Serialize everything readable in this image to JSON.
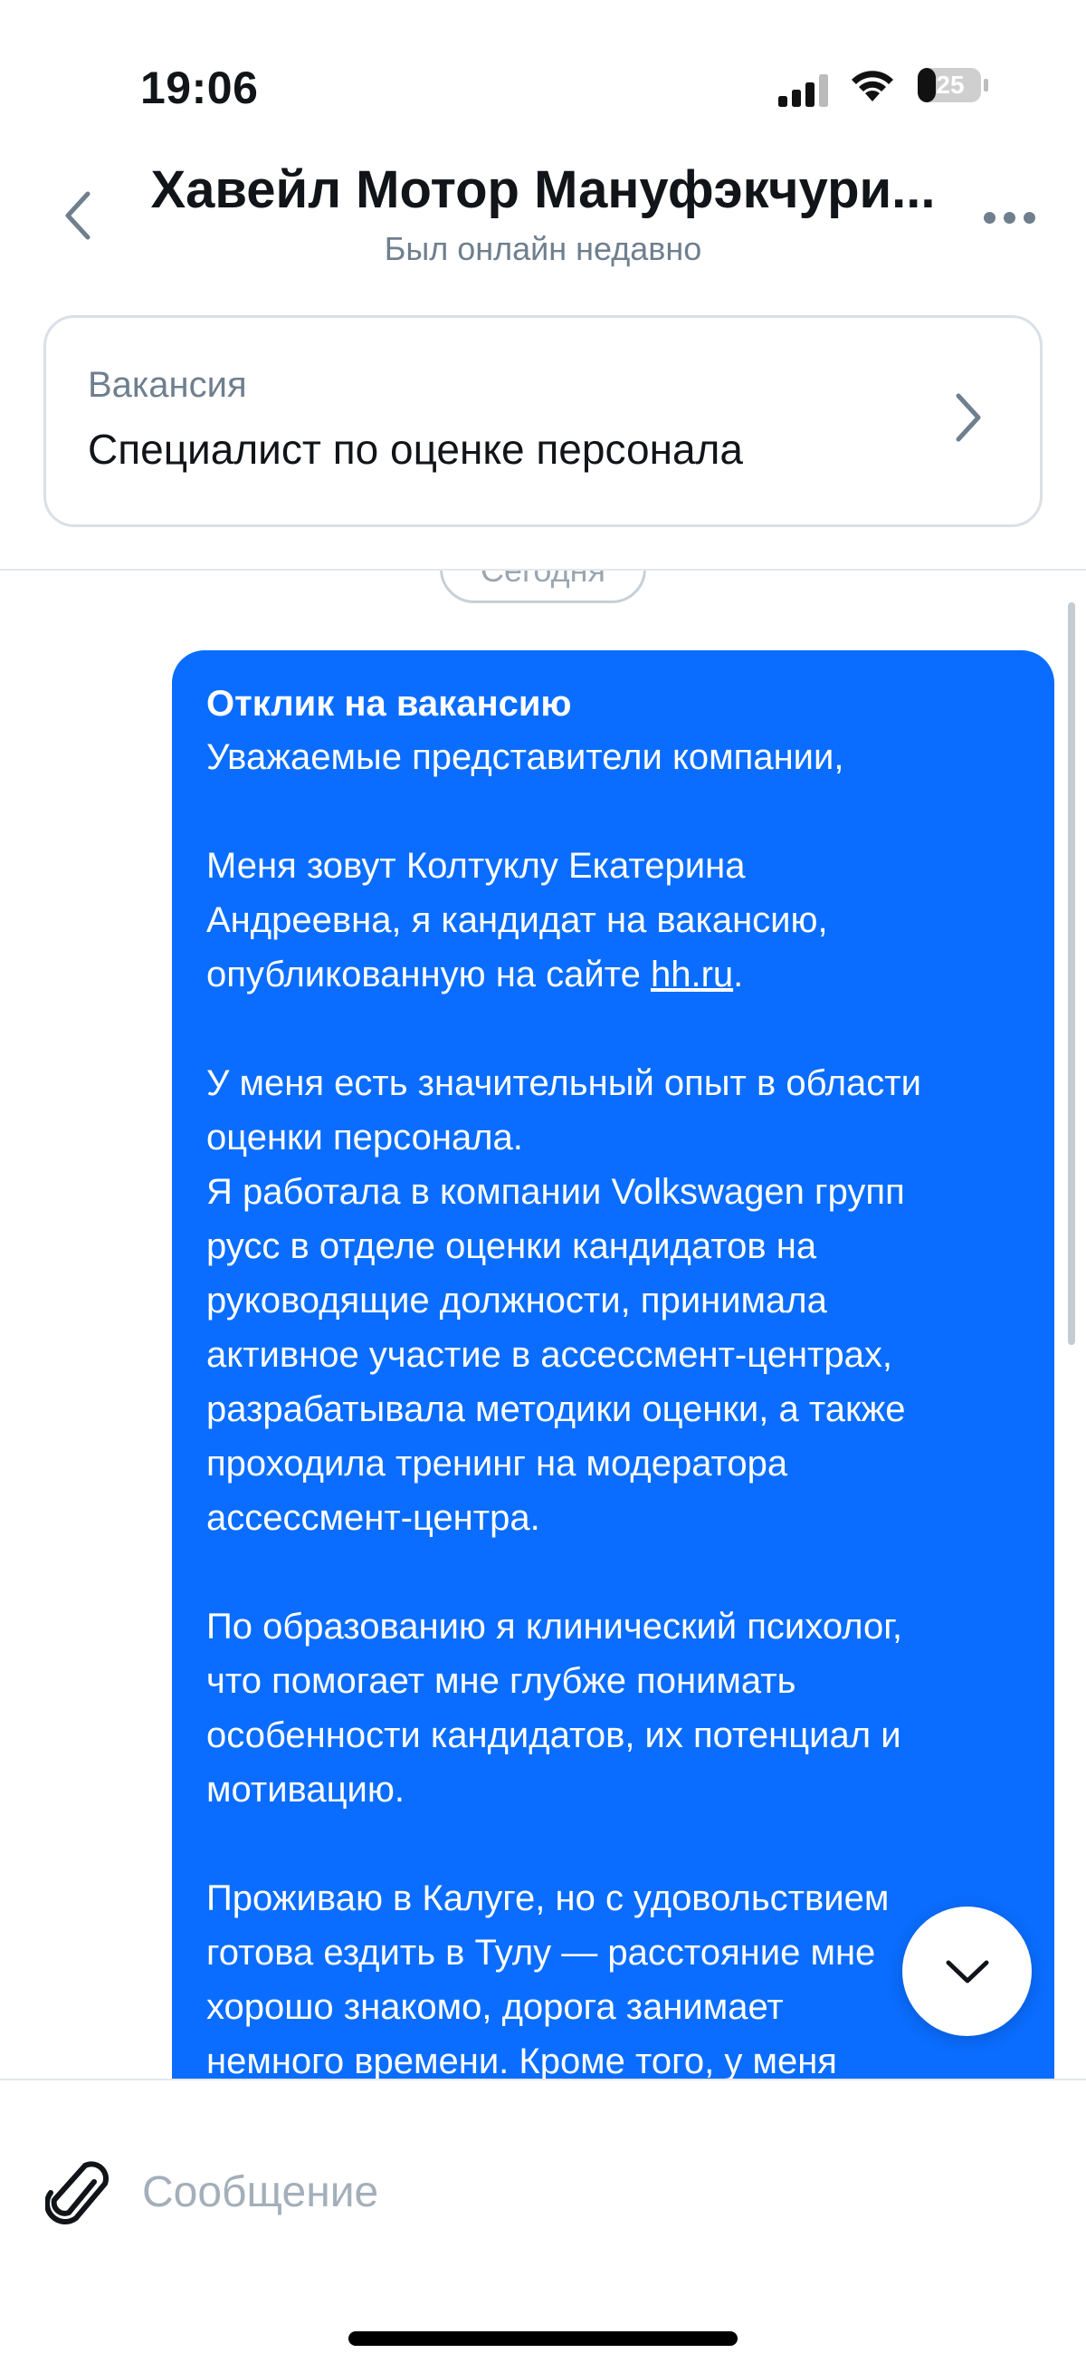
{
  "status_bar": {
    "time": "19:06",
    "battery": "25",
    "icons": [
      "signal-icon",
      "wifi-icon",
      "battery-icon"
    ]
  },
  "header": {
    "title": "Хавейл Мотор Мануфэкчури...",
    "subtitle": "Был онлайн недавно",
    "back_icon": "chevron-left-icon",
    "more_icon": "more-horizontal-icon"
  },
  "vacancy": {
    "label": "Вакансия",
    "title": "Специалист по оценке персонала",
    "chevron_icon": "chevron-right-icon"
  },
  "chat": {
    "date_label": "Сегодня",
    "message": {
      "heading": "Отклик на вакансию",
      "greeting": "Уважаемые представители компании,",
      "p2_line1": "Меня зовут Колтуклу Екатерина",
      "p2_line2": "Андреевна, я кандидат на вакансию,",
      "p2_line3_prefix": "опубликованную на сайте ",
      "p2_link": "hh.ru",
      "p2_line3_suffix": ".",
      "p3_line1": "У меня есть значительный опыт в области",
      "p3_line2": "оценки персонала.",
      "p3_line3": "Я работала в компании  Volkswagen групп",
      "p3_line4": "русс в отделе оценки кандидатов на",
      "p3_line5": "руководящие должности, принимала",
      "p3_line6": "активное участие в ассессмент-центрах,",
      "p3_line7": "разрабатывала методики оценки,  а также",
      "p3_line8": "проходила тренинг на модератора",
      "p3_line9": "ассессмент-центра.",
      "p4_line1": "По образованию я клинический психолог,",
      "p4_line2": "что помогает мне глубже понимать",
      "p4_line3": "особенности кандидатов, их потенциал и",
      "p4_line4": "мотивацию.",
      "p5_line1": "Проживаю в Калуге, но с удовольствием",
      "p5_line2": "готова ездить в Тулу — расстояние мне",
      "p5_line3": "хорошо знакомо, дорога занимает",
      "p5_line4": "немного времени. Кроме того, у меня"
    },
    "scroll_down_icon": "chevron-down-icon"
  },
  "composer": {
    "placeholder": "Сообщение",
    "value": "",
    "attach_icon": "paperclip-icon"
  },
  "colors": {
    "accent": "#0a6dff",
    "muted_text": "#6f7f8e",
    "border": "#d9e0e6"
  }
}
